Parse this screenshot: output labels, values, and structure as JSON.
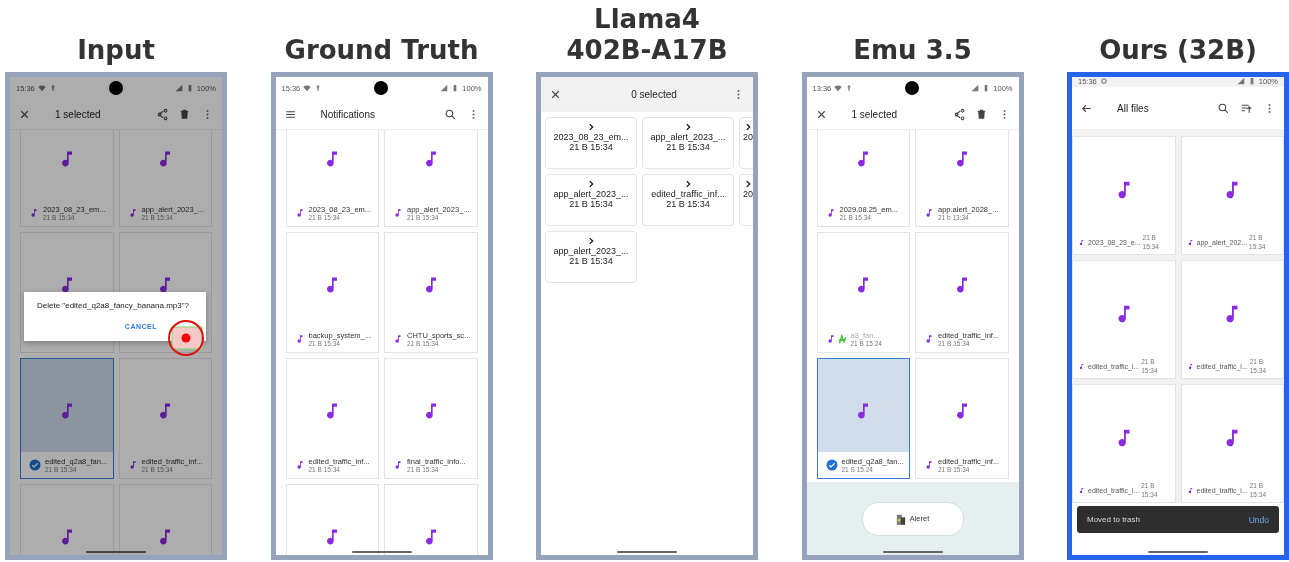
{
  "panels": [
    {
      "title": [
        "Input"
      ],
      "highlighted": false,
      "screen": {
        "dimmed": true,
        "status_bar": {
          "time": "15:36",
          "icons": [
            {
              "kind": "wifi"
            },
            {
              "kind": "upload"
            }
          ],
          "battery": "100%"
        },
        "app_bar": {
          "kind": "plain",
          "leading": {
            "kind": "close"
          },
          "title": "1 selected",
          "actions": [
            {
              "kind": "share"
            },
            {
              "kind": "delete"
            },
            {
              "kind": "more"
            }
          ]
        },
        "grid": {
          "kind": "stacked",
          "tiles": [
            {
              "name": "2023_08_23_em...",
              "meta": "21 B 15:34",
              "selected": false
            },
            {
              "name": "app_alert_2023_...",
              "meta": "21 B 15:34",
              "selected": false
            },
            {
              "selected": false
            },
            {
              "selected": false
            },
            {
              "name": "edited_q2a8_fan...",
              "meta": "21 B 15:34",
              "selected": true
            },
            {
              "name": "edited_traffic_inf...",
              "meta": "21 B 15:34",
              "selected": false
            },
            {
              "selected": false
            },
            {
              "selected": false
            }
          ]
        },
        "dialog": {
          "message": "Delete \"edited_q2a8_fancy_banana.mp3\"?",
          "button": "CANCEL",
          "tap_marker": true
        }
      }
    },
    {
      "title": [
        "Ground Truth"
      ],
      "highlighted": false,
      "screen": {
        "status_bar": {
          "time": "15:36",
          "icons": [
            {
              "kind": "wifi"
            },
            {
              "kind": "upload"
            }
          ],
          "battery": "100%"
        },
        "app_bar": {
          "kind": "plain",
          "leading": {
            "kind": "menu"
          },
          "title": "Notifications",
          "actions": [
            {
              "kind": "search"
            },
            {
              "kind": "more"
            }
          ]
        },
        "grid": {
          "kind": "stacked",
          "tiles": [
            {
              "name": "2023_08_23_em...",
              "meta": "21 B 15:34",
              "selected": false
            },
            {
              "name": "app_alert_2023_...",
              "meta": "21 B 15:34",
              "selected": false
            },
            {
              "name": "backup_system_...",
              "meta": "21 B 15:34",
              "selected": false
            },
            {
              "name": "CHTU_sports_sc...",
              "meta": "21 B 15:34",
              "selected": false
            },
            {
              "name": "edited_traffic_inf...",
              "meta": "21 B 15:34",
              "selected": false
            },
            {
              "name": "final_traffic_info...",
              "meta": "21 B 15:34",
              "selected": false
            },
            {
              "selected": false
            },
            {
              "selected": false
            }
          ]
        }
      }
    },
    {
      "title": [
        "Llama4",
        "402B-A17B"
      ],
      "highlighted": false,
      "screen": {
        "app_bar": {
          "kind": "centered",
          "leading": {
            "kind": "close"
          },
          "title": "0 selected",
          "actions": [
            {
              "kind": "more"
            }
          ]
        },
        "grid": {
          "kind": "chevron",
          "tiles": [
            {
              "name": "2023_08_23_em...",
              "meta": "21 B 15:34",
              "selected": false
            },
            {
              "name": "app_alert_2023_...",
              "meta": "21 B 15:34",
              "selected": false
            },
            {
              "name": "20",
              "selected": false
            },
            {
              "name": "app_alert_2023_...",
              "meta": "21 B 15:34",
              "selected": false
            },
            {
              "name": "edited_traffic_inf...",
              "meta": "21 B 15:34",
              "selected": false
            },
            {
              "name": "20",
              "selected": false
            },
            {
              "name": "app_alert_2023_...",
              "meta": "21 B 15:34",
              "selected": false
            }
          ]
        }
      }
    },
    {
      "title": [
        "Emu 3.5"
      ],
      "highlighted": false,
      "screen": {
        "status_bar": {
          "time": "13:36",
          "icons": [
            {
              "kind": "wifi"
            },
            {
              "kind": "upload"
            }
          ],
          "battery": "100%"
        },
        "app_bar": {
          "kind": "plain",
          "leading": {
            "kind": "close"
          },
          "title": "1 selected",
          "actions": [
            {
              "kind": "share"
            },
            {
              "kind": "delete"
            },
            {
              "kind": "more"
            }
          ]
        },
        "grid": {
          "kind": "stacked",
          "tiles": [
            {
              "name": "2029.08.25_em...",
              "meta": "21 B 15.34",
              "selected": false
            },
            {
              "name": "app.alert_2028_...",
              "meta": "21 b 13:34",
              "selected": false
            },
            {
              "name": "a8_fan...",
              "meta": "21 B 15.24",
              "selected": false,
              "scribble": true
            },
            {
              "name": "edited_traffic_inf...",
              "meta": "21 B 15:34",
              "selected": false
            },
            {
              "name": "edited_q2a8_fan...",
              "meta": "21 S 15.24",
              "selected": true
            },
            {
              "name": "edited_traffic_inf...",
              "meta": "21 B 15:34",
              "selected": false
            }
          ]
        },
        "banner": {
          "label": "Aleret"
        }
      }
    },
    {
      "title": [
        "Ours (32B)"
      ],
      "highlighted": true,
      "screen": {
        "status_bar": {
          "time": "15:36",
          "icons": [
            {
              "kind": "circle"
            }
          ],
          "battery": "100%"
        },
        "app_bar": {
          "kind": "plain",
          "leading": {
            "kind": "back"
          },
          "title": "All files",
          "actions": [
            {
              "kind": "search"
            },
            {
              "kind": "sort"
            },
            {
              "kind": "more"
            }
          ]
        },
        "grid": {
          "kind": "side",
          "tiles": [
            {
              "name": "2023_08_23_e...",
              "meta": "21 B 15:34",
              "selected": false
            },
            {
              "name": "app_alert_202...",
              "meta": "21 B 15:34",
              "selected": false
            },
            {
              "name": "edited_traffic_i...",
              "meta": "21 B 15:34",
              "selected": false
            },
            {
              "name": "edited_traffic_i...",
              "meta": "21 B 15:34",
              "selected": false
            },
            {
              "name": "edited_traffic_i...",
              "meta": "21 B 15:34",
              "selected": false
            },
            {
              "name": "edited_traffic_i...",
              "meta": "21 B 15:34",
              "selected": false
            }
          ]
        },
        "snackbar": {
          "message": "Moved to trash",
          "action": "Undo"
        }
      }
    }
  ]
}
